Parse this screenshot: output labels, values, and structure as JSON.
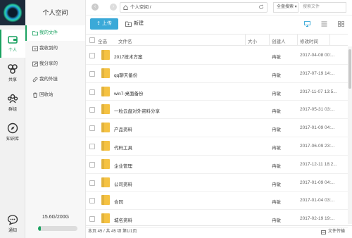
{
  "rail": {
    "items": [
      {
        "label": "个人",
        "icon": "wallet-icon",
        "active": true
      },
      {
        "label": "共享",
        "icon": "share-network-icon",
        "active": false
      },
      {
        "label": "群组",
        "icon": "group-icon",
        "active": false
      },
      {
        "label": "知识库",
        "icon": "compass-icon",
        "active": false
      },
      {
        "label": "通知",
        "icon": "chat-bubble-icon",
        "active": false
      }
    ]
  },
  "sidebar": {
    "title": "个人空间",
    "items": [
      {
        "label": "我的文件",
        "icon": "folder-icon",
        "active": true
      },
      {
        "label": "我收到的",
        "icon": "inbox-icon",
        "active": false
      },
      {
        "label": "我分享的",
        "icon": "share-icon",
        "active": false
      },
      {
        "label": "我的外链",
        "icon": "link-icon",
        "active": false
      },
      {
        "label": "回收站",
        "icon": "trash-icon",
        "active": false
      }
    ],
    "storage": "15.6G/200G",
    "storage_used_fraction": 0.078
  },
  "topbar": {
    "path": "个人空间 /",
    "scope": "全盘搜索 ▾",
    "search_placeholder": "搜索文件"
  },
  "toolbar": {
    "upload": "上传",
    "new_folder": "新建"
  },
  "table": {
    "headers": {
      "select_all": "全选",
      "name": "文件名",
      "size": "大小",
      "owner": "创建人",
      "modified": "修改时间"
    },
    "rows": [
      {
        "name": "2017技术方案",
        "owner": "冉敏",
        "modified": "2017-04-08 00:..."
      },
      {
        "name": "qq聊天备份",
        "owner": "冉敏",
        "modified": "2017-07-19 14:..."
      },
      {
        "name": "win7-桌面备份",
        "owner": "冉敏",
        "modified": "2017-11-07 13:5..."
      },
      {
        "name": "一粒云盘对外资料分享",
        "owner": "冉敏",
        "modified": "2017-05-31 03:..."
      },
      {
        "name": "产品资料",
        "owner": "冉敏",
        "modified": "2017-01-09 04:..."
      },
      {
        "name": "代码工具",
        "owner": "冉敏",
        "modified": "2017-06-09 23:..."
      },
      {
        "name": "企业管理",
        "owner": "冉敏",
        "modified": "2017-12-11 18:2..."
      },
      {
        "name": "公司资料",
        "owner": "冉敏",
        "modified": "2017-01-09 04:..."
      },
      {
        "name": "合同",
        "owner": "冉敏",
        "modified": "2017-01-04 03:..."
      },
      {
        "name": "城名资料",
        "owner": "冉敏",
        "modified": "2017-02-19 19:..."
      }
    ]
  },
  "footer": {
    "summary": "本页 45 / 共 45 项   第1/1页",
    "transfer": "文件传输"
  },
  "colors": {
    "accent": "#1aa260",
    "upload": "#3aa9d8",
    "folder": "#f5c242"
  }
}
